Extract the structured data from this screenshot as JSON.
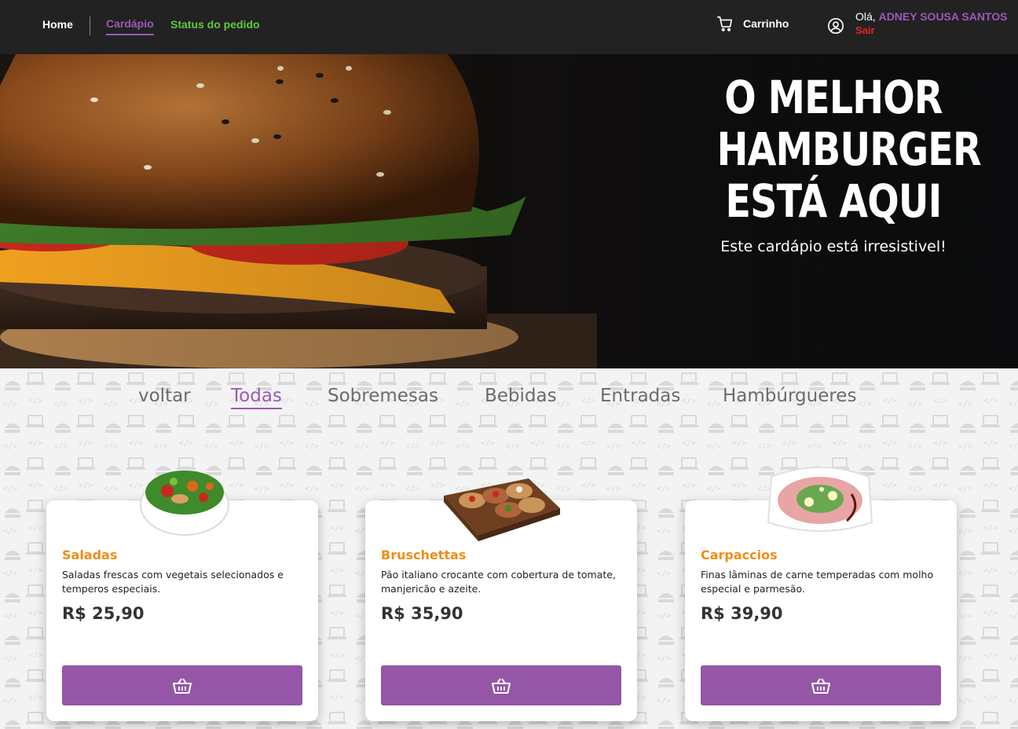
{
  "nav": {
    "home": "Home",
    "cardapio": "Cardápio",
    "status": "Status do pedido",
    "cart_label": "Carrinho",
    "greeting": "Olá,",
    "user_name": "ADNEY SOUSA SANTOS",
    "logout": "Sair"
  },
  "hero": {
    "title_line1": "O MELHOR",
    "title_line2": "HAMBURGER",
    "title_line3": "ESTÁ AQUI",
    "subtitle": "Este cardápio está irresistivel!"
  },
  "tabs": [
    {
      "label": "voltar",
      "active": false
    },
    {
      "label": "Todas",
      "active": true
    },
    {
      "label": "Sobremesas",
      "active": false
    },
    {
      "label": "Bebidas",
      "active": false
    },
    {
      "label": "Entradas",
      "active": false
    },
    {
      "label": "Hambúrgueres",
      "active": false
    }
  ],
  "products": [
    {
      "title": "Saladas",
      "description": "Saladas frescas com vegetais selecionados e temperos especiais.",
      "price": "R$ 25,90",
      "image": "salad-bowl"
    },
    {
      "title": "Bruschettas",
      "description": "Pão italiano crocante com cobertura de tomate, manjericão e azeite.",
      "price": "R$ 35,90",
      "image": "bruschetta-board"
    },
    {
      "title": "Carpaccios",
      "description": "Finas lâminas de carne temperadas com molho especial e parmesão.",
      "price": "R$ 39,90",
      "image": "carpaccio-plate"
    }
  ],
  "colors": {
    "navbar_bg": "#222222",
    "accent_purple": "#9b59b6",
    "button_purple": "#9556a8",
    "status_green": "#5fc93c",
    "logout_red": "#e8242a",
    "product_title_orange": "#f28c17"
  },
  "icons": {
    "cart": "cart-icon",
    "user": "user-circle-icon",
    "add_to_cart": "basket-icon"
  }
}
